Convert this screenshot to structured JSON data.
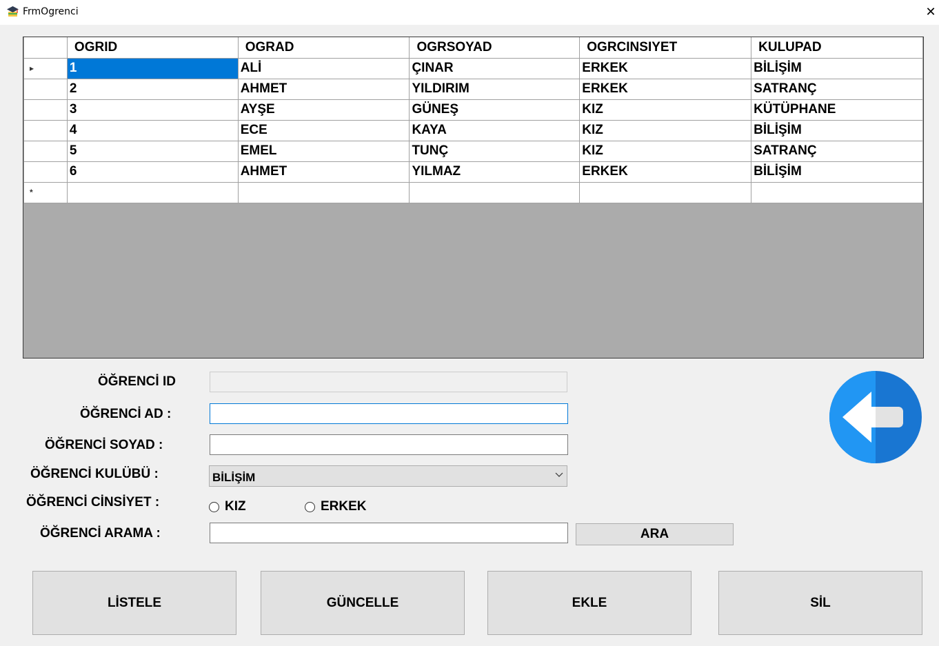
{
  "window": {
    "title": "FrmOgrenci",
    "close_glyph": "✕"
  },
  "grid": {
    "columns": [
      "OGRID",
      "OGRAD",
      "OGRSOYAD",
      "OGRCINSIYET",
      "KULUPAD"
    ],
    "rows": [
      [
        "1",
        "ALİ",
        "ÇINAR",
        "ERKEK",
        "BİLİŞİM"
      ],
      [
        "2",
        "AHMET",
        "YILDIRIM",
        "ERKEK",
        "SATRANÇ"
      ],
      [
        "3",
        "AYŞE",
        "GÜNEŞ",
        "KIZ",
        "KÜTÜPHANE"
      ],
      [
        "4",
        "ECE",
        "KAYA",
        "KIZ",
        "BİLİŞİM"
      ],
      [
        "5",
        "EMEL",
        "TUNÇ",
        "KIZ",
        "SATRANÇ"
      ],
      [
        "6",
        "AHMET",
        "YILMAZ",
        "ERKEK",
        "BİLİŞİM"
      ]
    ],
    "current_row_marker": "▸",
    "new_row_marker": "*"
  },
  "form": {
    "id_label": "ÖĞRENCİ ID",
    "ad_label": "ÖĞRENCİ AD :",
    "soyad_label": "ÖĞRENCİ SOYAD :",
    "kulup_label": "ÖĞRENCİ KULÜBÜ :",
    "cinsiyet_label": "ÖĞRENCİ CİNSİYET :",
    "arama_label": "ÖĞRENCİ ARAMA :",
    "kulup_selected": "BİLİŞİM",
    "radio_kiz": "KIZ",
    "radio_erkek": "ERKEK",
    "ara_button": "ARA"
  },
  "buttons": {
    "listele": "LİSTELE",
    "guncelle": "GÜNCELLE",
    "ekle": "EKLE",
    "sil": "SİL"
  },
  "colors": {
    "selection": "#0078d7",
    "back_icon_light": "#2196f3",
    "back_icon_dark": "#1976d2"
  },
  "icons": {
    "app": "graduation-cap-icon",
    "back": "back-arrow-icon"
  }
}
